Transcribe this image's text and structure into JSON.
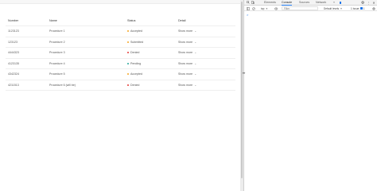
{
  "table": {
    "headers": {
      "number": "Number",
      "name": "Name",
      "status": "Status",
      "detail": "Detail"
    },
    "rows": [
      {
        "number": "1123123",
        "name": "Procedure 1",
        "status": "Accepted",
        "status_color": "#f5a623",
        "detail": "Show more"
      },
      {
        "number": "123123",
        "name": "Procedure 2",
        "status": "Submitted",
        "status_color": "#f5a623",
        "detail": "Show more"
      },
      {
        "number": "4444323",
        "name": "Procedure 3",
        "status": "Denied",
        "status_color": "#e53935",
        "detail": "Show more"
      },
      {
        "number": "4123135",
        "name": "Procedure 4",
        "status": "Pending",
        "status_color": "#26a69a",
        "detail": "Show more"
      },
      {
        "number": "4342324",
        "name": "Procedure 5",
        "status": "Accepted",
        "status_color": "#f5a623",
        "detail": "Show more"
      },
      {
        "number": "4211513",
        "name": "Procedure 6 (will be)",
        "status": "Denied",
        "status_color": "#e53935",
        "detail": "Show more"
      }
    ]
  },
  "devtools": {
    "tabs": [
      "Elements",
      "Console",
      "Sources",
      "Network"
    ],
    "active_tab": "Console",
    "more_tabs": "»",
    "context": "top",
    "filter_placeholder": "Filter",
    "levels": "Default levels",
    "issues": "1 Issue:",
    "issues_count": "1",
    "prompt": ">",
    "icons": {
      "inspect": "inspect-icon",
      "device": "device-toolbar-icon",
      "settings": "gear-icon",
      "more": "kebab-menu-icon",
      "close": "close-icon",
      "clear": "clear-console-icon",
      "eye": "eye-icon",
      "sidebar": "console-sidebar-icon"
    }
  }
}
